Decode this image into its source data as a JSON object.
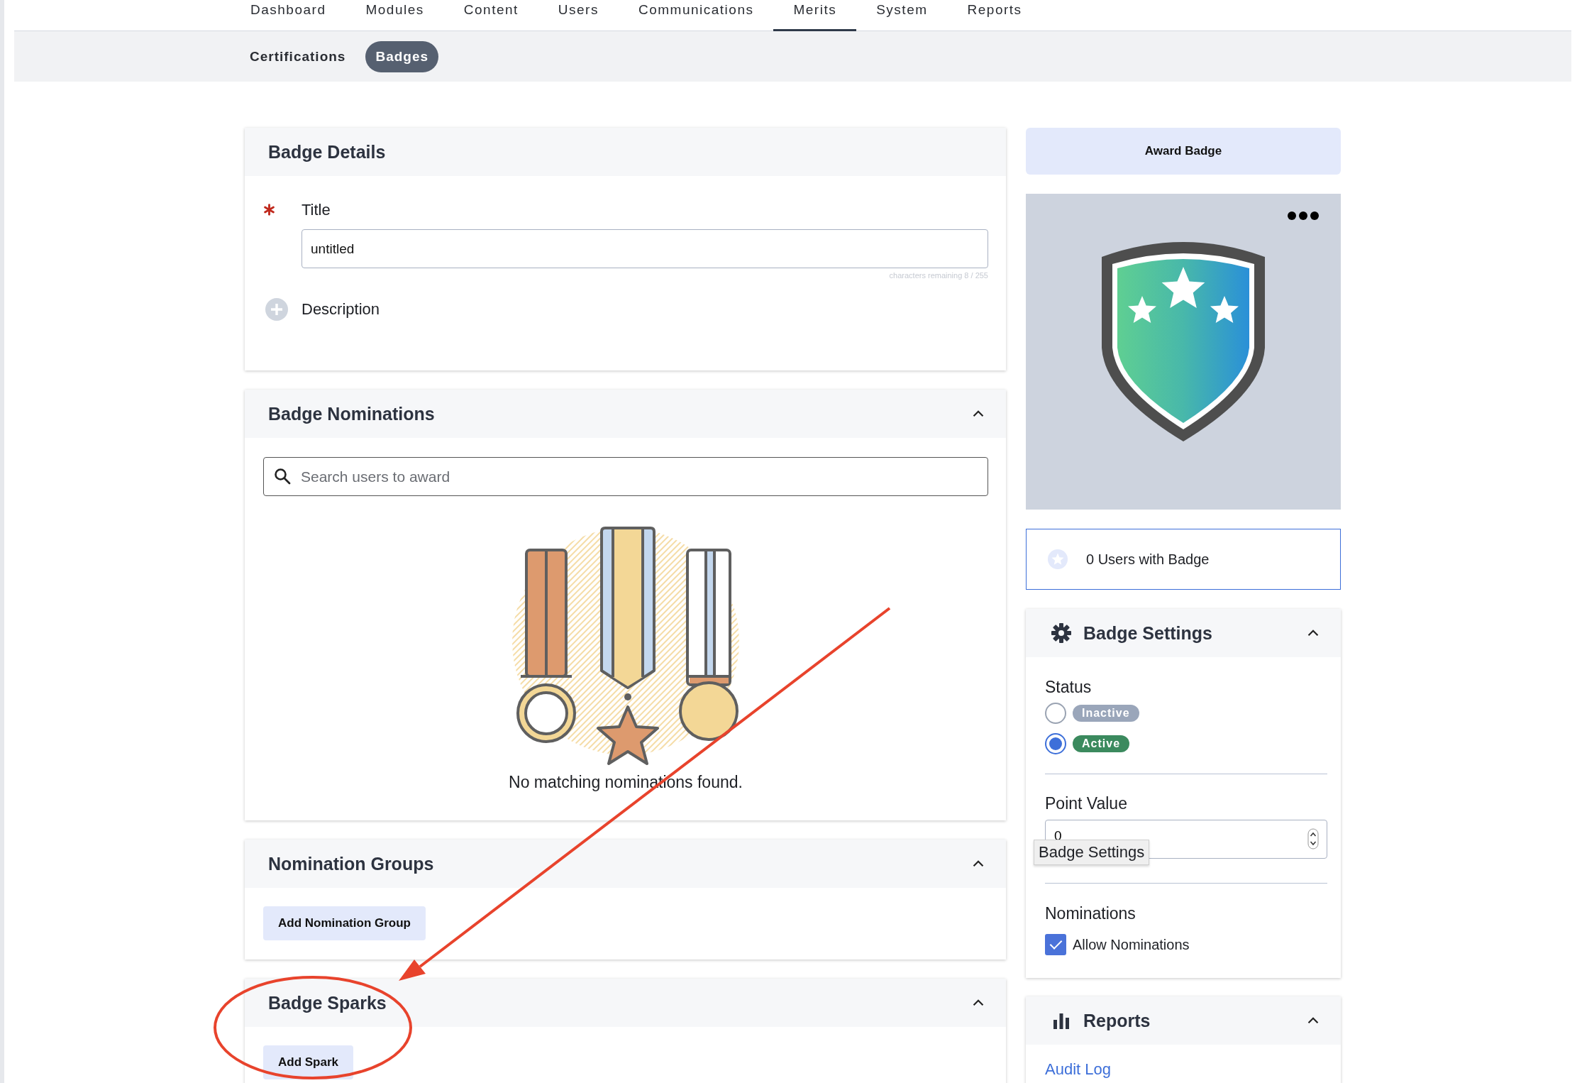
{
  "nav": {
    "tabs": [
      {
        "label": "Dashboard",
        "selected": false
      },
      {
        "label": "Modules",
        "selected": false
      },
      {
        "label": "Content",
        "selected": false
      },
      {
        "label": "Users",
        "selected": false
      },
      {
        "label": "Communications",
        "selected": false
      },
      {
        "label": "Merits",
        "selected": true
      },
      {
        "label": "System",
        "selected": false
      },
      {
        "label": "Reports",
        "selected": false
      }
    ]
  },
  "subnav": {
    "tabs": [
      {
        "label": "Certifications",
        "selected": false
      },
      {
        "label": "Badges",
        "selected": true
      }
    ]
  },
  "badge_details": {
    "title": "Badge Details",
    "title_field": {
      "label": "Title",
      "required": true,
      "value": "untitled",
      "counter": "characters remaining 8 / 255"
    },
    "description_label": "Description"
  },
  "nominations": {
    "title": "Badge Nominations",
    "expanded": true,
    "search": {
      "placeholder": "Search users to award"
    },
    "empty_message": "No matching nominations found."
  },
  "nomination_groups": {
    "title": "Nomination Groups",
    "expanded": true,
    "button": "Add Nomination Group"
  },
  "sparks": {
    "title": "Badge Sparks",
    "expanded": true,
    "button": "Add Spark"
  },
  "award_button": "Award Badge",
  "users_with_badge": "0 Users with Badge",
  "settings": {
    "title": "Badge Settings",
    "expanded": true,
    "status_label": "Status",
    "status_options": [
      {
        "label": "Inactive",
        "selected": false,
        "color": "#9aa6ba"
      },
      {
        "label": "Active",
        "selected": true,
        "color": "#3b8a5e"
      }
    ],
    "point_label": "Point Value",
    "point_value": "0",
    "tooltip": "Badge Settings",
    "nominations_label": "Nominations",
    "allow": {
      "label": "Allow Nominations",
      "checked": true
    }
  },
  "reports": {
    "title": "Reports",
    "expanded": true,
    "links": [
      "Audit Log"
    ]
  }
}
